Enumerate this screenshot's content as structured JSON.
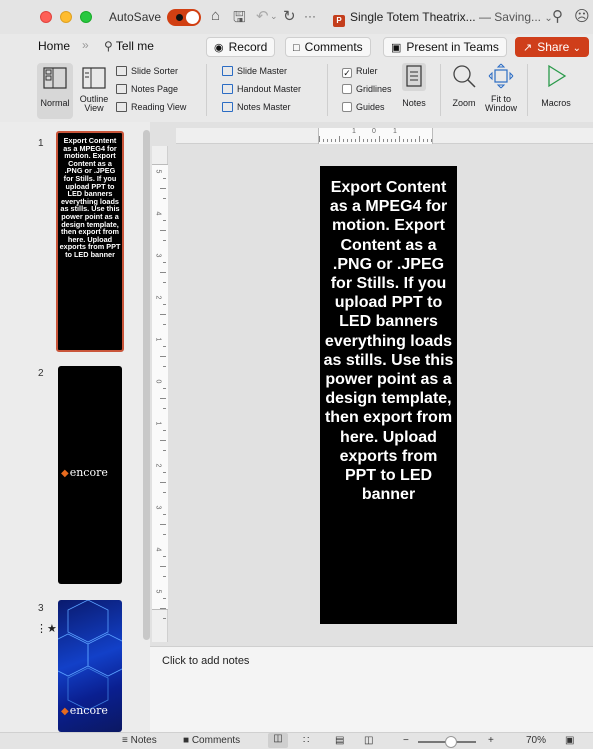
{
  "titlebar": {
    "autosave_label": "AutoSave",
    "doc_title": "Single Totem Theatrix...",
    "doc_status": "— Saving...",
    "autosave_state": "on"
  },
  "tabs": {
    "home": "Home",
    "tell_me": "Tell me",
    "record": "Record",
    "comments": "Comments",
    "present_in_teams": "Present in Teams",
    "share": "Share"
  },
  "ribbon": {
    "normal": "Normal",
    "outline_view": "Outline\nView",
    "slide_sorter": "Slide Sorter",
    "notes_page": "Notes Page",
    "reading_view": "Reading View",
    "slide_master": "Slide Master",
    "handout_master": "Handout Master",
    "notes_master": "Notes Master",
    "ruler": "Ruler",
    "gridlines": "Gridlines",
    "guides": "Guides",
    "notes": "Notes",
    "zoom": "Zoom",
    "fit_to_window": "Fit to\nWindow",
    "macros": "Macros",
    "ruler_checked": true,
    "gridlines_checked": false,
    "guides_checked": false
  },
  "slides": {
    "numbers": [
      "1",
      "2",
      "3"
    ],
    "brand": "encore",
    "slide1_text": "Export Content as a  MPEG4 for motion. Export Content as a .PNG or .JPEG for Stills. If you upload PPT to LED banners everything loads as stills. Use this power point as a design template, then export from here. Upload exports from PPT to LED banner"
  },
  "ruler": {
    "h_labels": [
      "1",
      "0",
      "1"
    ],
    "v_labels": [
      "5",
      "4",
      "3",
      "2",
      "1",
      "0",
      "1",
      "2",
      "3",
      "4",
      "5"
    ]
  },
  "notes": {
    "placeholder": "Click to add notes"
  },
  "statusbar": {
    "notes": "Notes",
    "comments": "Comments",
    "zoom_minus": "−",
    "zoom_plus": "+",
    "zoom_level": "70%"
  },
  "colors": {
    "accent": "#cf3e1a",
    "selection_border": "#c9553a",
    "slide_bg": "#000000",
    "slide_text": "#ffffff"
  }
}
